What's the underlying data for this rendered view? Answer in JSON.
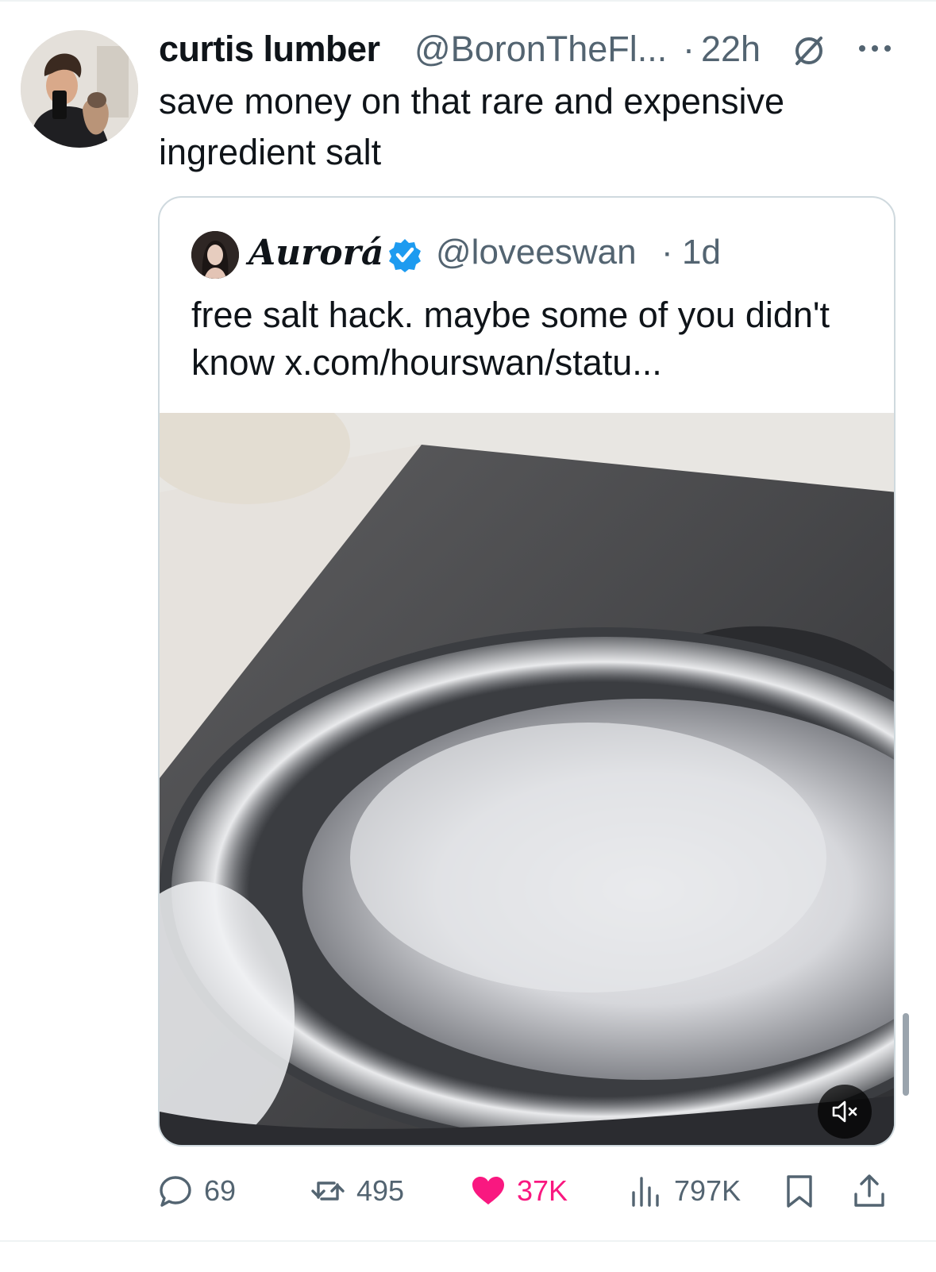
{
  "tweet": {
    "author_name": "curtis lumber",
    "author_handle": "@BoronTheFl...",
    "separator": "·",
    "time": "22h",
    "text": "save money on that rare and expensive ingredient salt"
  },
  "quote": {
    "author_name": "Aurorá",
    "author_handle": "@loveeswan",
    "separator": "·",
    "time": "1d",
    "text": "free salt hack. maybe some of you didn't know x.com/hourswan/statu..."
  },
  "actions": {
    "replies": "69",
    "reposts": "495",
    "likes": "37K",
    "views": "797K"
  },
  "icons": {
    "avatar": "avatar",
    "translate": "translate-icon",
    "more": "more-icon",
    "verified": "verified-icon",
    "mute": "mute-icon",
    "reply": "reply-icon",
    "repost": "repost-icon",
    "like": "heart-icon",
    "views": "views-icon",
    "bookmark": "bookmark-icon",
    "share": "share-icon"
  },
  "colors": {
    "text": "#0f1419",
    "secondary": "#536471",
    "like": "#f91880",
    "verified": "#1d9bf0",
    "border": "#cfd9de"
  }
}
